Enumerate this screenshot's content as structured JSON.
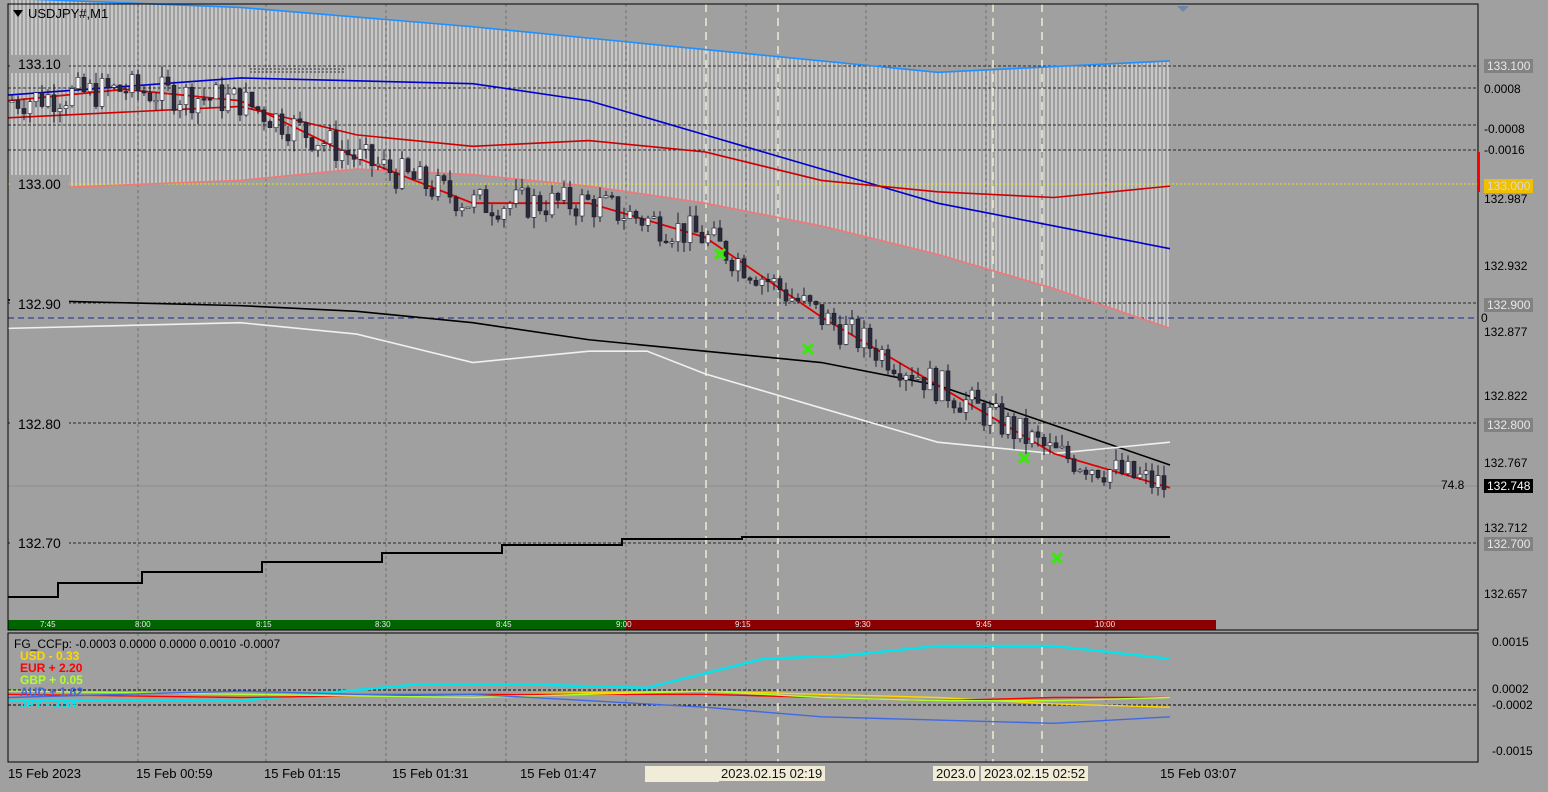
{
  "chart_data": [
    {
      "type": "candlestick",
      "title": "USDJPY#,M1",
      "ylim": [
        132.625,
        133.175
      ],
      "price_labels": [
        "133.10",
        "133.00",
        "132.90",
        "132.80",
        "132.70"
      ],
      "y_axis_labels": [
        "133.100",
        "0.0008",
        "-0.0008",
        "-0.0016",
        "133.000",
        "132.987",
        "132.932",
        "132.900",
        "0",
        "132.877",
        "132.822",
        "132.800",
        "132.767",
        "74.8",
        "132.748",
        "132.712",
        "132.700",
        "132.657"
      ],
      "x_axis_labels": [
        "15 Feb 2023",
        "15 Feb 00:59",
        "15 Feb 01:15",
        "15 Feb 01:31",
        "15 Feb 01:47",
        "2023.02.15 02:19",
        "2023.0",
        "2023.02.15 02:52",
        "15 Feb 03:07"
      ],
      "session_times": [
        "7:45",
        "8:00",
        "8:15",
        "8:30",
        "8:45",
        "9:00",
        "9:15",
        "9:30",
        "9:45",
        "10:00"
      ],
      "current_price": 132.748,
      "series": [
        {
          "color": "#1e90ff",
          "x": [
            0,
            0.2,
            0.4,
            0.6,
            0.8,
            1.0
          ],
          "y": [
            133.18,
            133.172,
            133.155,
            133.135,
            133.115,
            133.125
          ]
        },
        {
          "color": "#0000cc",
          "x": [
            0,
            0.2,
            0.4,
            0.5,
            0.6,
            0.7,
            0.8,
            0.9,
            1.0
          ],
          "y": [
            133.095,
            133.11,
            133.105,
            133.09,
            133.06,
            133.03,
            133.0,
            132.98,
            132.96
          ]
        },
        {
          "color": "#cc0000",
          "x": [
            0,
            0.2,
            0.3,
            0.4,
            0.5,
            0.6,
            0.7,
            0.8,
            0.9,
            1.0
          ],
          "y": [
            133.075,
            133.085,
            133.06,
            133.05,
            133.055,
            133.045,
            133.02,
            133.01,
            133.005,
            133.015
          ]
        },
        {
          "color": "#f07878",
          "x": [
            0,
            0.2,
            0.3,
            0.4,
            0.5,
            0.6,
            0.7,
            0.8,
            0.9,
            1.0
          ],
          "y": [
            133.012,
            133.02,
            133.03,
            133.025,
            133.015,
            133.0,
            132.98,
            132.955,
            132.925,
            132.89
          ]
        },
        {
          "color": "#000000",
          "x": [
            0,
            0.2,
            0.3,
            0.4,
            0.5,
            0.6,
            0.7,
            0.8,
            0.9,
            1.0
          ],
          "y": [
            132.915,
            132.91,
            132.905,
            132.895,
            132.88,
            132.87,
            132.86,
            132.84,
            132.805,
            132.77
          ]
        },
        {
          "color": "#f0f0f0",
          "x": [
            0,
            0.2,
            0.3,
            0.4,
            0.5,
            0.55,
            0.6,
            0.7,
            0.8,
            0.9,
            1.0
          ],
          "y": [
            132.89,
            132.895,
            132.885,
            132.86,
            132.87,
            132.87,
            132.85,
            132.82,
            132.79,
            132.78,
            132.79
          ]
        },
        {
          "color": "#e00000",
          "x": [
            0,
            0.1,
            0.2,
            0.3,
            0.4,
            0.5,
            0.6,
            0.7,
            0.8,
            0.9,
            1.0
          ],
          "y": [
            133.09,
            133.1,
            133.09,
            133.04,
            133.0,
            133.0,
            132.97,
            132.9,
            132.84,
            132.78,
            132.75
          ]
        }
      ]
    },
    {
      "type": "line",
      "title": "FG_CCFp: -0.0003 0.0000 0.0000 0.0010 -0.0007",
      "ylim": [
        -0.002,
        0.002
      ],
      "y_axis_labels": [
        "0.0015",
        "0.0002",
        "-0.0002",
        "-0.0015"
      ],
      "legend": [
        {
          "name": "USD -  0.33",
          "color": "#ffd700"
        },
        {
          "name": "EUR +  2.20",
          "color": "#ff0000"
        },
        {
          "name": "GBP +  0.05",
          "color": "#adff2f"
        },
        {
          "name": "AUD +  1.62",
          "color": "#4169e1"
        },
        {
          "name": "JPY -  3.54",
          "color": "#00e5ee"
        }
      ],
      "series": [
        {
          "color": "#00e5ee",
          "x": [
            0,
            0.2,
            0.35,
            0.45,
            0.55,
            0.65,
            0.72,
            0.8,
            0.9,
            1.0
          ],
          "y": [
            -0.0001,
            -0.0001,
            0.0004,
            0.0004,
            0.0003,
            0.0012,
            0.0013,
            0.0016,
            0.0016,
            0.0012
          ]
        },
        {
          "color": "#ffd700",
          "x": [
            0,
            0.2,
            0.4,
            0.6,
            0.7,
            0.8,
            0.9,
            1.0
          ],
          "y": [
            0.0001,
            0.0,
            0.0001,
            0.0002,
            0.0001,
            0.0,
            -0.0002,
            -0.0003
          ]
        },
        {
          "color": "#ff0000",
          "x": [
            0,
            0.2,
            0.4,
            0.6,
            0.7,
            0.8,
            0.9,
            1.0
          ],
          "y": [
            0.0001,
            0.0,
            0.0001,
            0.0001,
            0.0,
            -0.0001,
            0.0,
            0.0
          ]
        },
        {
          "color": "#adff2f",
          "x": [
            0,
            0.2,
            0.4,
            0.6,
            0.7,
            0.8,
            0.9,
            1.0
          ],
          "y": [
            0.0002,
            0.0001,
            0.0,
            0.0002,
            0.0,
            -0.0001,
            -0.0001,
            0.0
          ]
        },
        {
          "color": "#4169e1",
          "x": [
            0,
            0.2,
            0.3,
            0.4,
            0.5,
            0.6,
            0.7,
            0.8,
            0.9,
            1.0
          ],
          "y": [
            0.0,
            0.0002,
            0.0001,
            0.0001,
            -0.0001,
            -0.0003,
            -0.0006,
            -0.0007,
            -0.0008,
            -0.0006
          ]
        }
      ]
    }
  ]
}
